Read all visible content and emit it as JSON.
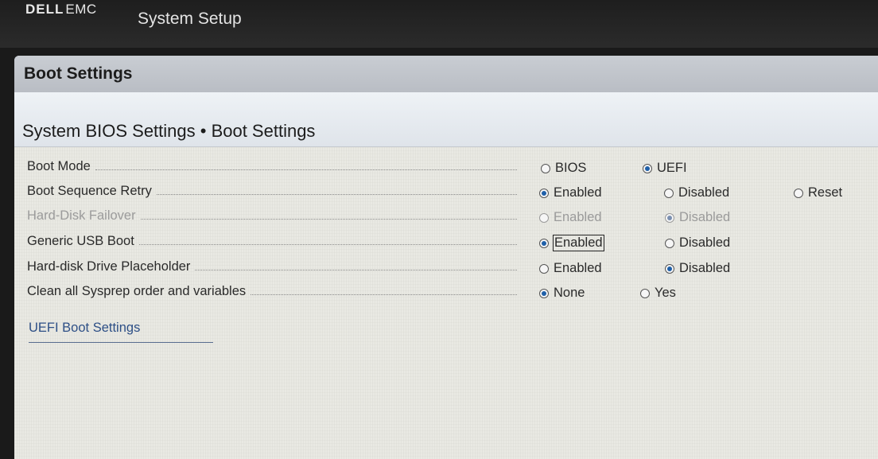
{
  "header": {
    "brand_dell": "DELL",
    "brand_emc": "EMC",
    "app_title": "System Setup"
  },
  "panel": {
    "title": "Boot Settings",
    "subtitle": "System BIOS Settings • Boot Settings"
  },
  "settings": [
    {
      "label": "Boot Mode",
      "disabled": false,
      "options": [
        {
          "label": "BIOS",
          "selected": false
        },
        {
          "label": "UEFI",
          "selected": true
        }
      ]
    },
    {
      "label": "Boot Sequence Retry",
      "disabled": false,
      "options": [
        {
          "label": "Enabled",
          "selected": true
        },
        {
          "label": "Disabled",
          "selected": false
        },
        {
          "label": "Reset",
          "selected": false
        }
      ]
    },
    {
      "label": "Hard-Disk Failover",
      "disabled": true,
      "options": [
        {
          "label": "Enabled",
          "selected": false
        },
        {
          "label": "Disabled",
          "selected": true
        }
      ]
    },
    {
      "label": "Generic USB Boot",
      "disabled": false,
      "focused_option": 0,
      "options": [
        {
          "label": "Enabled",
          "selected": true
        },
        {
          "label": "Disabled",
          "selected": false
        }
      ]
    },
    {
      "label": "Hard-disk Drive Placeholder",
      "disabled": false,
      "options": [
        {
          "label": "Enabled",
          "selected": false
        },
        {
          "label": "Disabled",
          "selected": true
        }
      ]
    },
    {
      "label": "Clean all Sysprep order and variables",
      "disabled": false,
      "options": [
        {
          "label": "None",
          "selected": true
        },
        {
          "label": "Yes",
          "selected": false
        }
      ]
    }
  ],
  "links": {
    "uefi_boot_settings": "UEFI Boot Settings"
  },
  "colors": {
    "radio_selected": "#1e5fa8",
    "link": "#2d4f86",
    "disabled_text": "#9b9b9b"
  }
}
